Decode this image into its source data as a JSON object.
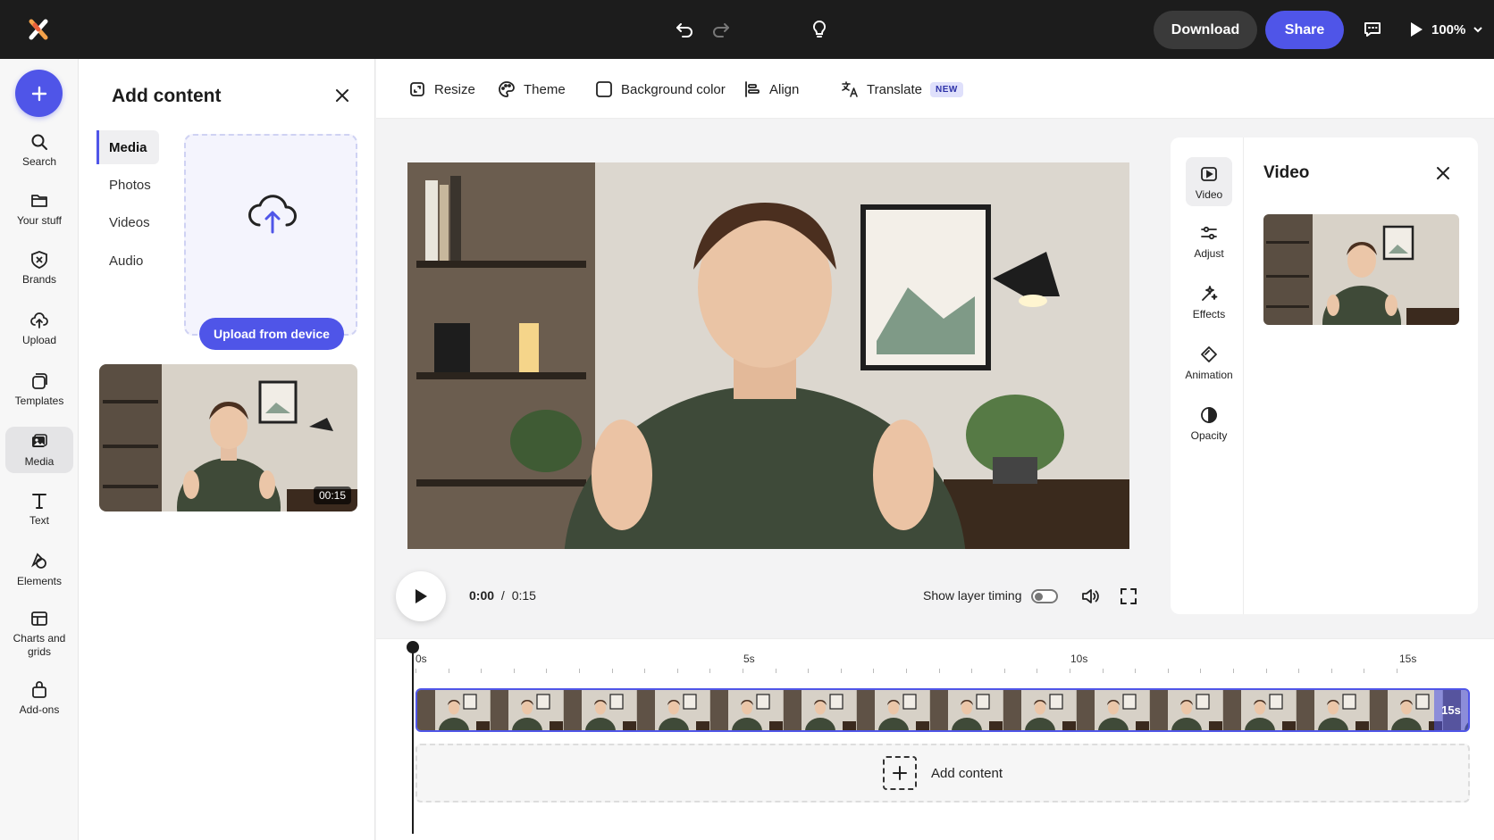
{
  "topbar": {
    "download_label": "Download",
    "share_label": "Share",
    "zoom_label": "100%",
    "accent_color": "#4f55e8"
  },
  "rail": {
    "items": [
      {
        "label": "Search",
        "icon": "search-icon"
      },
      {
        "label": "Your stuff",
        "icon": "folder-icon"
      },
      {
        "label": "Brands",
        "icon": "brands-icon"
      },
      {
        "label": "Upload",
        "icon": "upload-cloud-icon"
      },
      {
        "label": "Templates",
        "icon": "templates-icon"
      },
      {
        "label": "Media",
        "icon": "media-icon",
        "active": true
      },
      {
        "label": "Text",
        "icon": "text-icon"
      },
      {
        "label": "Elements",
        "icon": "elements-icon"
      },
      {
        "label": "Charts and grids",
        "icon": "charts-grids-icon"
      },
      {
        "label": "Add-ons",
        "icon": "addons-icon"
      }
    ]
  },
  "panel": {
    "title": "Add content",
    "nav": [
      "Media",
      "Photos",
      "Videos",
      "Audio"
    ],
    "active_nav": "Media",
    "upload_label": "Upload from device",
    "thumb_duration": "00:15"
  },
  "toolbar": {
    "resize": "Resize",
    "theme": "Theme",
    "background_color": "Background color",
    "align": "Align",
    "translate": "Translate",
    "new_badge": "NEW"
  },
  "player": {
    "current_time": "0:00",
    "separator": "/",
    "total_time": "0:15",
    "layer_timing_label": "Show layer timing",
    "layer_timing_on": false
  },
  "props": {
    "title": "Video",
    "tabs": [
      {
        "label": "Video",
        "icon": "video-icon",
        "active": true
      },
      {
        "label": "Adjust",
        "icon": "adjust-sliders-icon"
      },
      {
        "label": "Effects",
        "icon": "effects-icon"
      },
      {
        "label": "Animation",
        "icon": "animation-icon"
      },
      {
        "label": "Opacity",
        "icon": "opacity-icon"
      }
    ]
  },
  "timeline": {
    "ruler": [
      "0s",
      "5s",
      "10s",
      "15s"
    ],
    "clip_end_label": "15s",
    "add_content_label": "Add content"
  }
}
